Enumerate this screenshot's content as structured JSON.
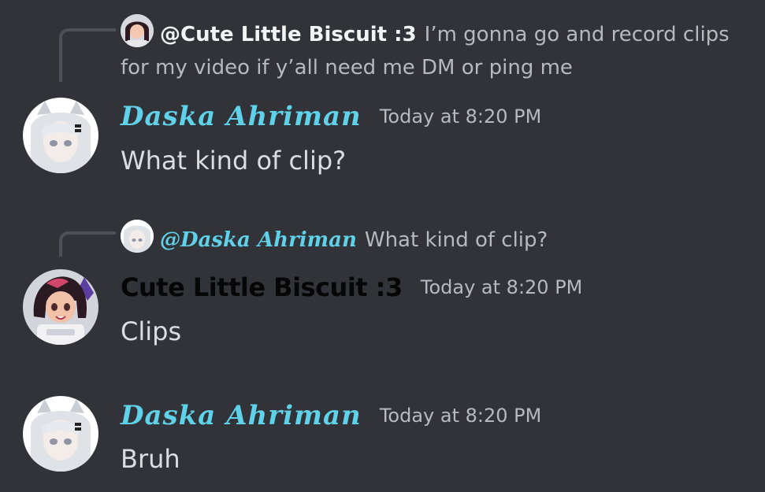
{
  "messages": [
    {
      "reply": {
        "author": "@Cute Little Biscuit :3",
        "text": "I’m gonna go and record clips for my video if y’all need me DM or ping me"
      },
      "author": "Daska Ahriman",
      "timestamp": "Today at 8:20 PM",
      "content": "What kind of clip?"
    },
    {
      "reply": {
        "author": "@Daska Ahriman",
        "text": "What kind of clip?"
      },
      "author": "Cute Little Biscuit :3",
      "timestamp": "Today at 8:20 PM",
      "content": "Clips"
    },
    {
      "author": "Daska Ahriman",
      "timestamp": "Today at 8:20 PM",
      "content": "Bruh"
    }
  ],
  "colors": {
    "background": "#313338",
    "fancy_name": "#5fd1e8",
    "timestamp": "#b5bac1",
    "message_text": "#dbdee1",
    "reply_line": "#4e5058"
  }
}
